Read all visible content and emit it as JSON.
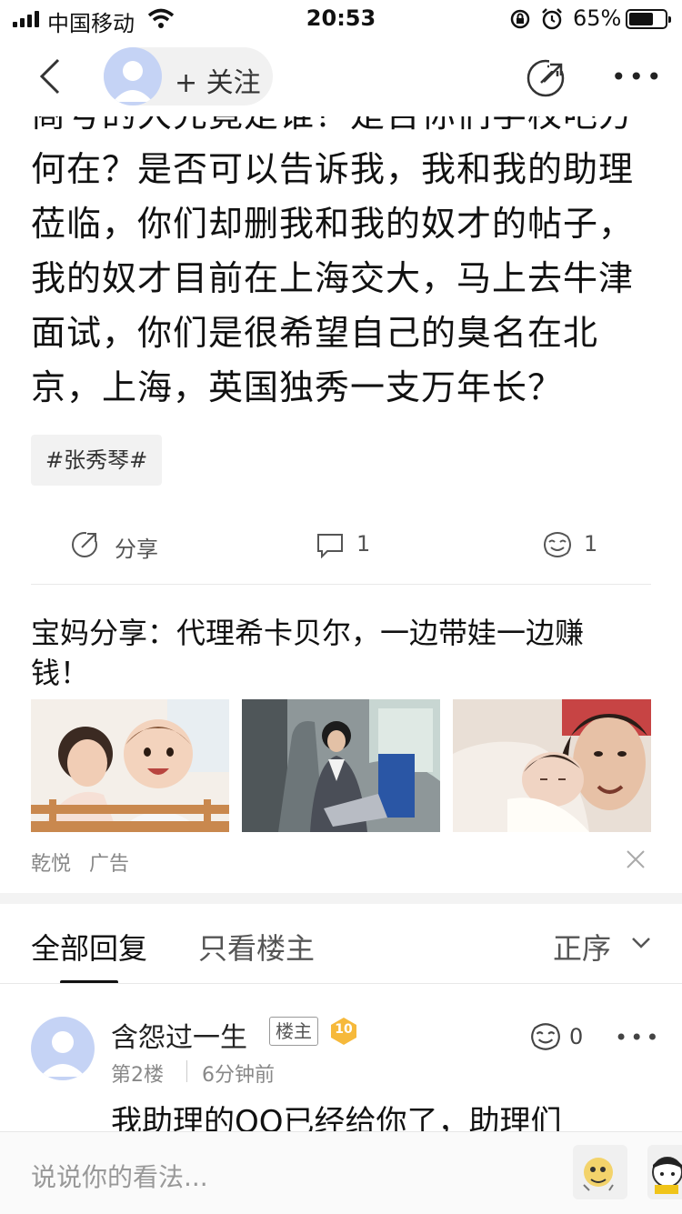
{
  "status_bar": {
    "carrier": "中国移动",
    "time": "20:53",
    "battery": "65%"
  },
  "nav": {
    "follow_label": "+ 关注"
  },
  "post": {
    "lines": [
      "商号的大先竟是谁？是否你们学校吧方",
      "何在？是否可以告诉我，我和我的助理",
      "莅临，你们却删我和我的奴才的帖子，",
      "我的奴才目前在上海交大，马上去牛津",
      "面试，你们是很希望自己的臭名在北",
      "京，上海，英国独秀一支万年长？"
    ],
    "tag": "#张秀琴#",
    "actions": {
      "share_label": "分享",
      "comment_count": "1",
      "like_count": "1"
    }
  },
  "ad": {
    "title": "宝妈分享：代理希卡贝尔，一边带娃一边赚钱！",
    "source": "乾悦",
    "label": "广告"
  },
  "tabs": {
    "all": "全部回复",
    "op_only": "只看楼主",
    "sort": "正序"
  },
  "comment": {
    "name": "含怨过一生",
    "badge": "楼主",
    "level": "10",
    "floor": "第2楼",
    "time": "6分钟前",
    "likes": "0",
    "text": "我助理的QQ已经给你了，助理们"
  },
  "input": {
    "placeholder": "说说你的看法..."
  }
}
